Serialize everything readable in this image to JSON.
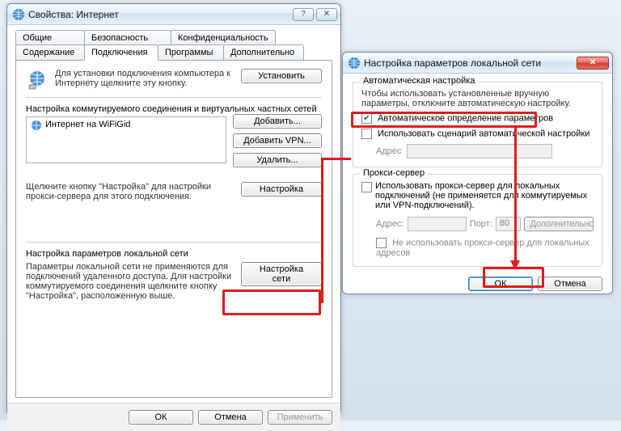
{
  "dialog1": {
    "title": "Свойства: Интернет",
    "tabs_row1": [
      "Общие",
      "Безопасность",
      "Конфиденциальность"
    ],
    "tabs_row2": [
      "Содержание",
      "Подключения",
      "Программы",
      "Дополнительно"
    ],
    "active_tab": "Подключения",
    "setup_text": "Для установки подключения компьютера к Интернету щелкните эту кнопку.",
    "setup_btn": "Установить",
    "dialup_header": "Настройка коммутируемого соединения и виртуальных частных сетей",
    "conn_name": "Интернет на WiFiGid",
    "btn_add": "Добавить...",
    "btn_add_vpn": "Добавить VPN...",
    "btn_delete": "Удалить...",
    "settings_hint": "Щелкните кнопку \"Настройка\" для настройки прокси-сервера для этого подключения.",
    "btn_settings": "Настройка",
    "lan_header": "Настройка параметров локальной сети",
    "lan_hint": "Параметры локальной сети не применяются для подключений удаленного доступа. Для настройки коммутируемого соединения щелкните кнопку \"Настройка\", расположенную выше.",
    "btn_lan": "Настройка сети",
    "footer": {
      "ok": "ОК",
      "cancel": "Отмена",
      "apply": "Применить"
    }
  },
  "dialog2": {
    "title": "Настройка параметров локальной сети",
    "auto_group": "Автоматическая настройка",
    "auto_hint": "Чтобы использовать установленные вручную параметры, отключите автоматическую настройку.",
    "chk_auto_detect": "Автоматическое определение параметров",
    "chk_use_script": "Использовать сценарий автоматической настройки",
    "addr_label": "Адрес",
    "proxy_group": "Прокси-сервер",
    "chk_use_proxy": "Использовать прокси-сервер для локальных подключений (не применяется для коммутируемых или VPN-подключений).",
    "proxy_addr_label": "Адрес:",
    "proxy_port_label": "Порт:",
    "proxy_port_value": "80",
    "btn_adv": "Дополнительно",
    "chk_bypass": "Не использовать прокси-сервер для локальных адресов",
    "footer": {
      "ok": "ОК",
      "cancel": "Отмена"
    }
  }
}
